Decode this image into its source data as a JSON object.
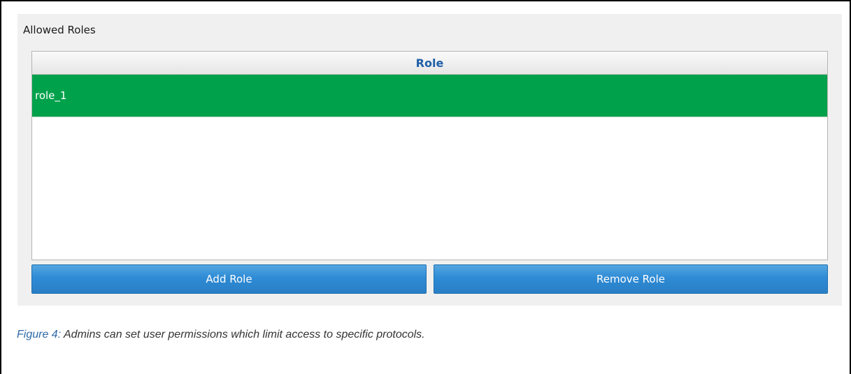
{
  "group": {
    "label": "Allowed Roles"
  },
  "table": {
    "columns": [
      "Role"
    ],
    "rows": [
      {
        "role": "role_1",
        "selected": true
      }
    ]
  },
  "buttons": {
    "add_label": "Add Role",
    "remove_label": "Remove Role"
  },
  "caption": {
    "prefix": "Figure 4:",
    "text": " Admins can set user permissions which limit access to specific protocols."
  },
  "colors": {
    "selected_row": "#00a14b",
    "header_text": "#1f5fa8",
    "button": "#2e8bd5",
    "caption_prefix": "#2f6aa8"
  }
}
